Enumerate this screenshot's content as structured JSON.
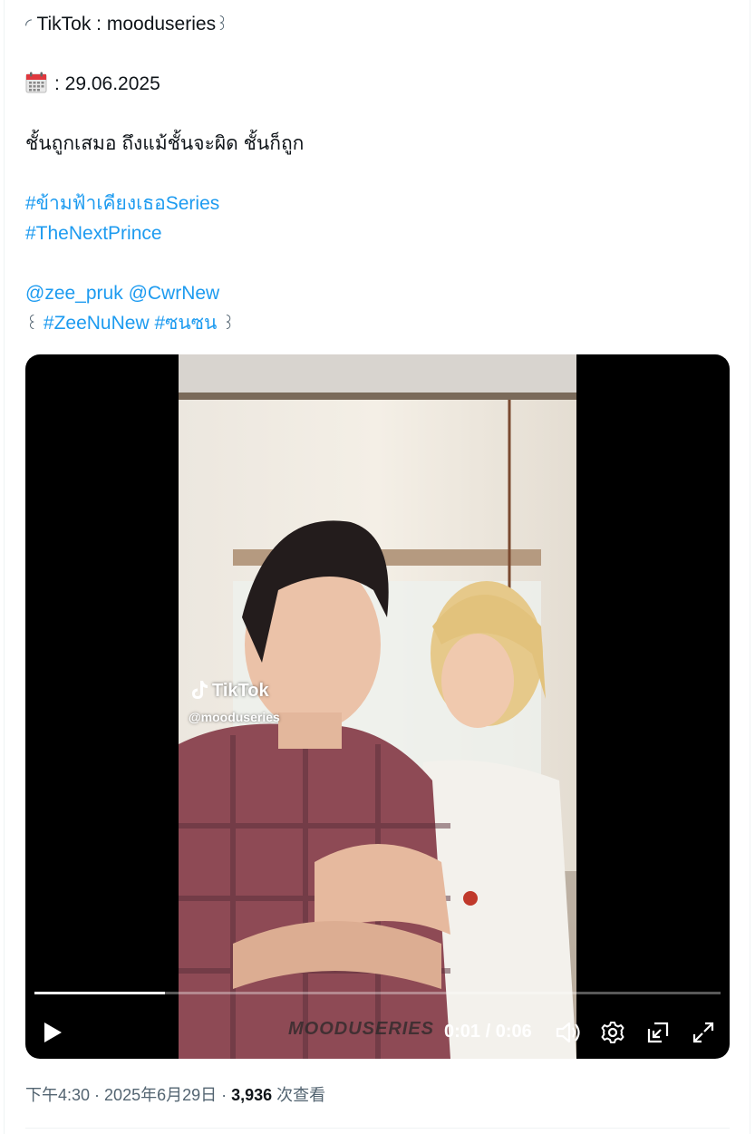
{
  "tweet": {
    "line1_open": "◜",
    "line1_text": "TikTok : mooduseries",
    "line1_close": "꒱",
    "date_label": ": 29.06.2025",
    "date_icon": "calendar-icon",
    "thai_text": "ชั้นถูกเสมอ ถึงแม้ชั้นจะผิด ชั้นก็ถูก",
    "hashtag1": "#ข้ามฟ้าเคียงเธอSeries",
    "hashtag2": "#TheNextPrince",
    "mention1": "@zee_pruk",
    "mention2": "@CwrNew",
    "deco_left": "꒰",
    "hashtag3": "#ZeeNuNew",
    "hashtag4": "#ซนซน",
    "deco_right": "꒱"
  },
  "video": {
    "overlay_brand": "TikTok",
    "overlay_handle": "@mooduseries",
    "watermark": "MOODUSERIES",
    "time_display": "0:01 / 0:06",
    "progress": 0.19,
    "icons": [
      "play-icon",
      "volume-icon",
      "settings-icon",
      "pip-icon",
      "fullscreen-icon"
    ]
  },
  "meta": {
    "time": "下午4:30",
    "sep1": " · ",
    "date": "2025年6月29日",
    "sep2": " · ",
    "views": "3,936",
    "views_label": " 次查看"
  },
  "colors": {
    "link": "#1d9bf0",
    "text": "#0f1419",
    "secondary": "#536471"
  }
}
